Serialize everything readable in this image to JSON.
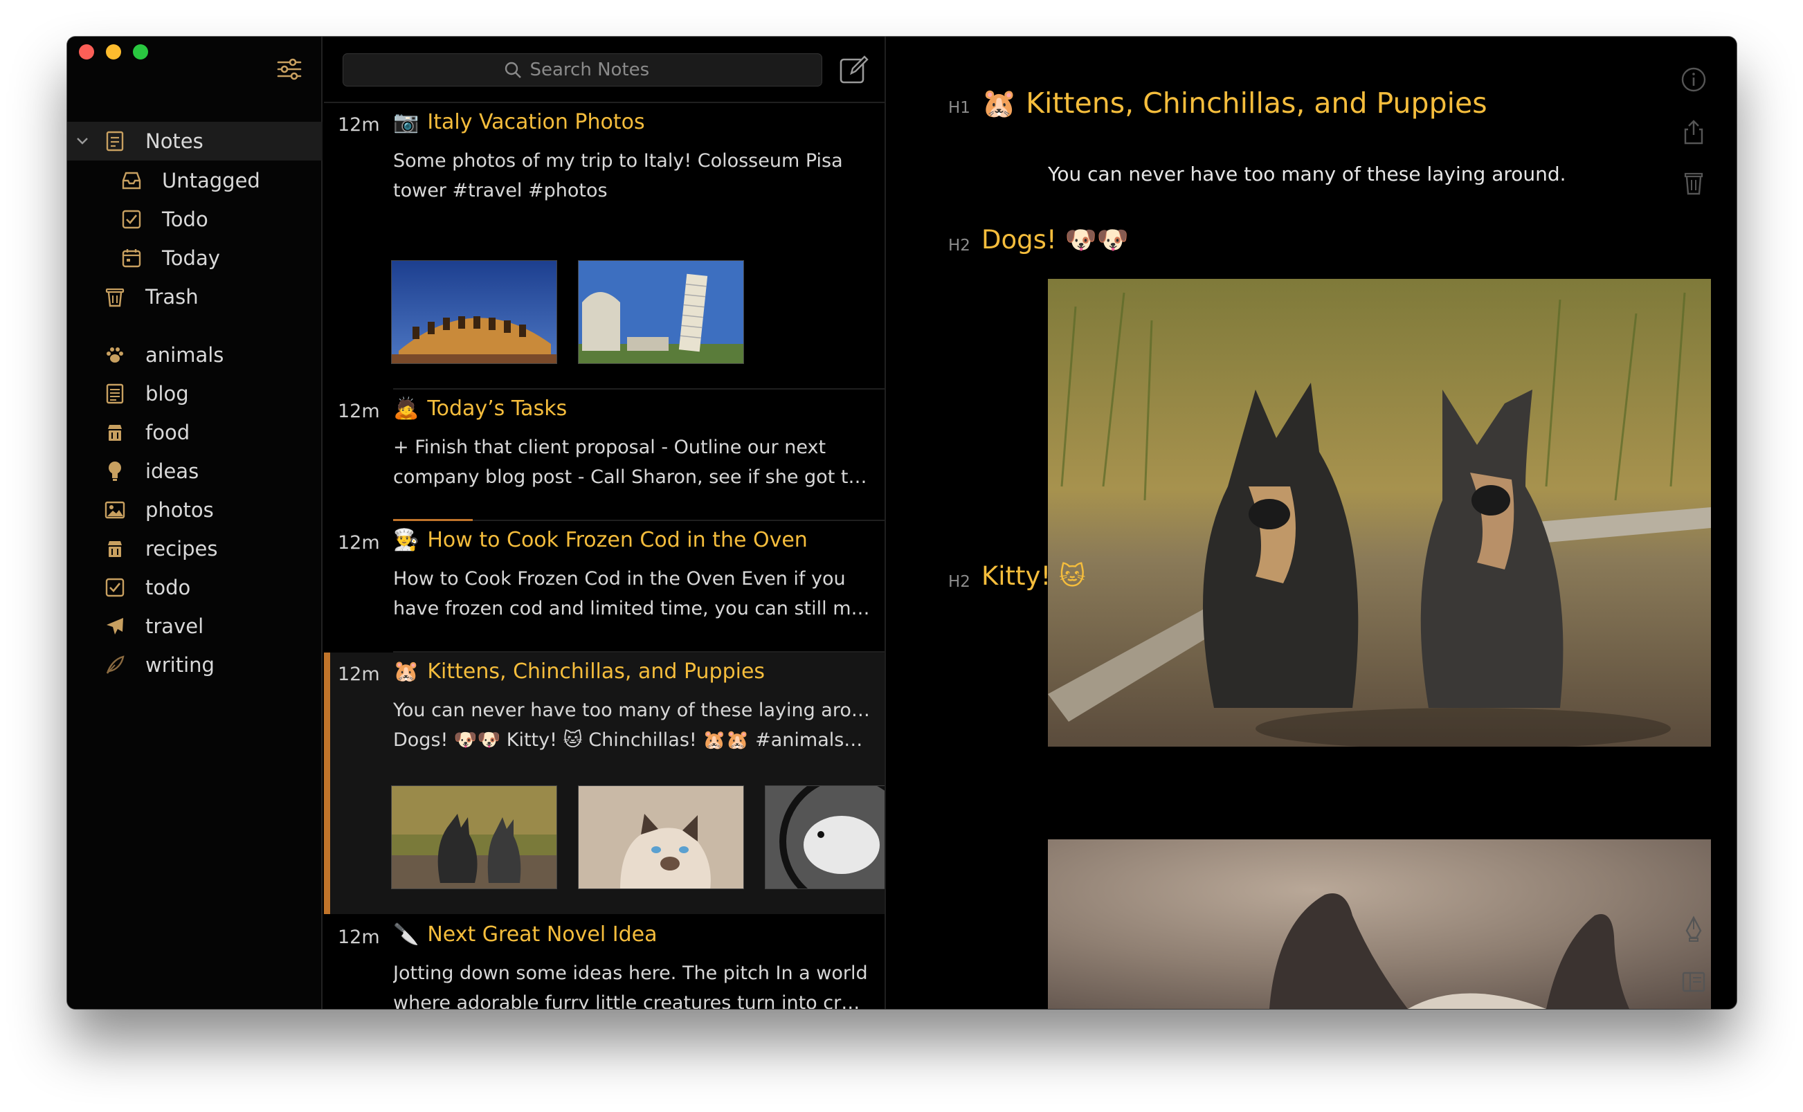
{
  "sidebar": {
    "items": [
      {
        "key": "notes",
        "label": "Notes",
        "icon": "notes-icon"
      },
      {
        "key": "untagged",
        "label": "Untagged",
        "icon": "inbox-icon"
      },
      {
        "key": "todo",
        "label": "Todo",
        "icon": "checkbox-icon"
      },
      {
        "key": "today",
        "label": "Today",
        "icon": "calendar-icon"
      },
      {
        "key": "trash",
        "label": "Trash",
        "icon": "trash-icon"
      }
    ],
    "tags": [
      {
        "label": "animals",
        "icon": "paw-icon"
      },
      {
        "label": "blog",
        "icon": "document-icon"
      },
      {
        "label": "food",
        "icon": "food-icon"
      },
      {
        "label": "ideas",
        "icon": "lightbulb-icon"
      },
      {
        "label": "photos",
        "icon": "image-icon"
      },
      {
        "label": "recipes",
        "icon": "food-icon"
      },
      {
        "label": "todo",
        "icon": "checkbox-icon"
      },
      {
        "label": "travel",
        "icon": "airplane-icon"
      },
      {
        "label": "writing",
        "icon": "feather-icon"
      }
    ]
  },
  "list": {
    "search_placeholder": "Search Notes",
    "notes": [
      {
        "age": "12m",
        "emoji": "📷",
        "title": "Italy Vacation Photos",
        "line1": "Some photos of my trip to Italy! Colosseum Pisa",
        "line2": "tower #travel #photos"
      },
      {
        "age": "12m",
        "emoji": "🙇",
        "title": "Today’s Tasks",
        "line1": "+ Finish that client proposal - Outline our next",
        "line2": "company blog post - Call Sharon, see if she got tha…"
      },
      {
        "age": "12m",
        "emoji": "👨‍🍳",
        "title": "How to Cook Frozen Cod in the Oven",
        "line1": "How to Cook Frozen Cod in the Oven Even if you",
        "line2": "have frozen cod and limited time, you can still mak…"
      },
      {
        "age": "12m",
        "emoji": "🐹",
        "title": "Kittens, Chinchillas, and Puppies",
        "line1": "You can never have too many of these laying around.",
        "line2": "Dogs! 🐶🐶 Kitty! 🐱 Chinchillas! 🐹🐹 #animals…"
      },
      {
        "age": "12m",
        "emoji": "🔪",
        "title": "Next Great Novel Idea",
        "line1": "Jotting down some ideas here. The pitch In a world",
        "line2": "where adorable furry little creatures turn into craze…"
      }
    ]
  },
  "editor": {
    "h1_mark": "H1",
    "h1": "🐹 Kittens, Chinchillas, and Puppies",
    "intro": "You can never have too many of these laying around.",
    "h2_dogs_mark": "H2",
    "h2_dogs": "Dogs! 🐶🐶",
    "h2_kitty_mark": "H2",
    "h2_kitty": "Kitty! 🐱"
  },
  "colors": {
    "accent": "#f5bd3c",
    "selection_bar": "#c0742a",
    "icon": "#c8a060"
  }
}
